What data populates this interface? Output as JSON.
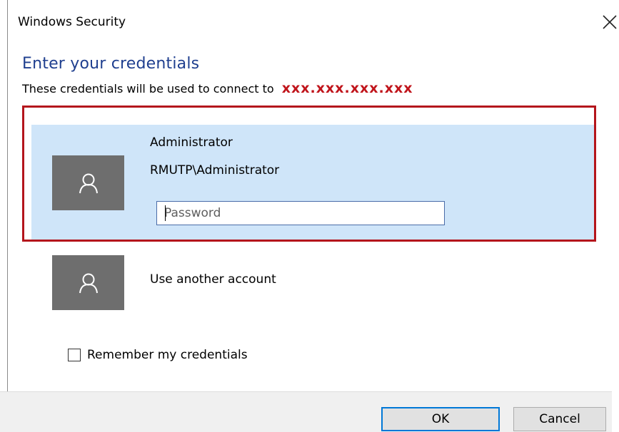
{
  "window": {
    "title": "Windows Security",
    "close_icon": "close-icon"
  },
  "prompt": {
    "heading": "Enter your credentials",
    "subline": "These credentials will be used to connect to",
    "server": "xxx.xxx.xxx.xxx"
  },
  "accounts": [
    {
      "name": "Administrator",
      "domain": "RMUTP\\Administrator",
      "icon": "user-icon",
      "selected": true
    },
    {
      "label": "Use another account",
      "icon": "user-icon",
      "selected": false
    }
  ],
  "password": {
    "placeholder": "Password",
    "value": ""
  },
  "remember": {
    "label": "Remember my credentials",
    "checked": false
  },
  "buttons": {
    "ok": "OK",
    "cancel": "Cancel"
  },
  "colors": {
    "heading": "#1f3f8f",
    "server": "#c0141b",
    "highlight_border": "#b4151c",
    "selected_bg": "#cfe5f9",
    "avatar_bg": "#6e6e6e",
    "ok_border": "#0078d7"
  }
}
